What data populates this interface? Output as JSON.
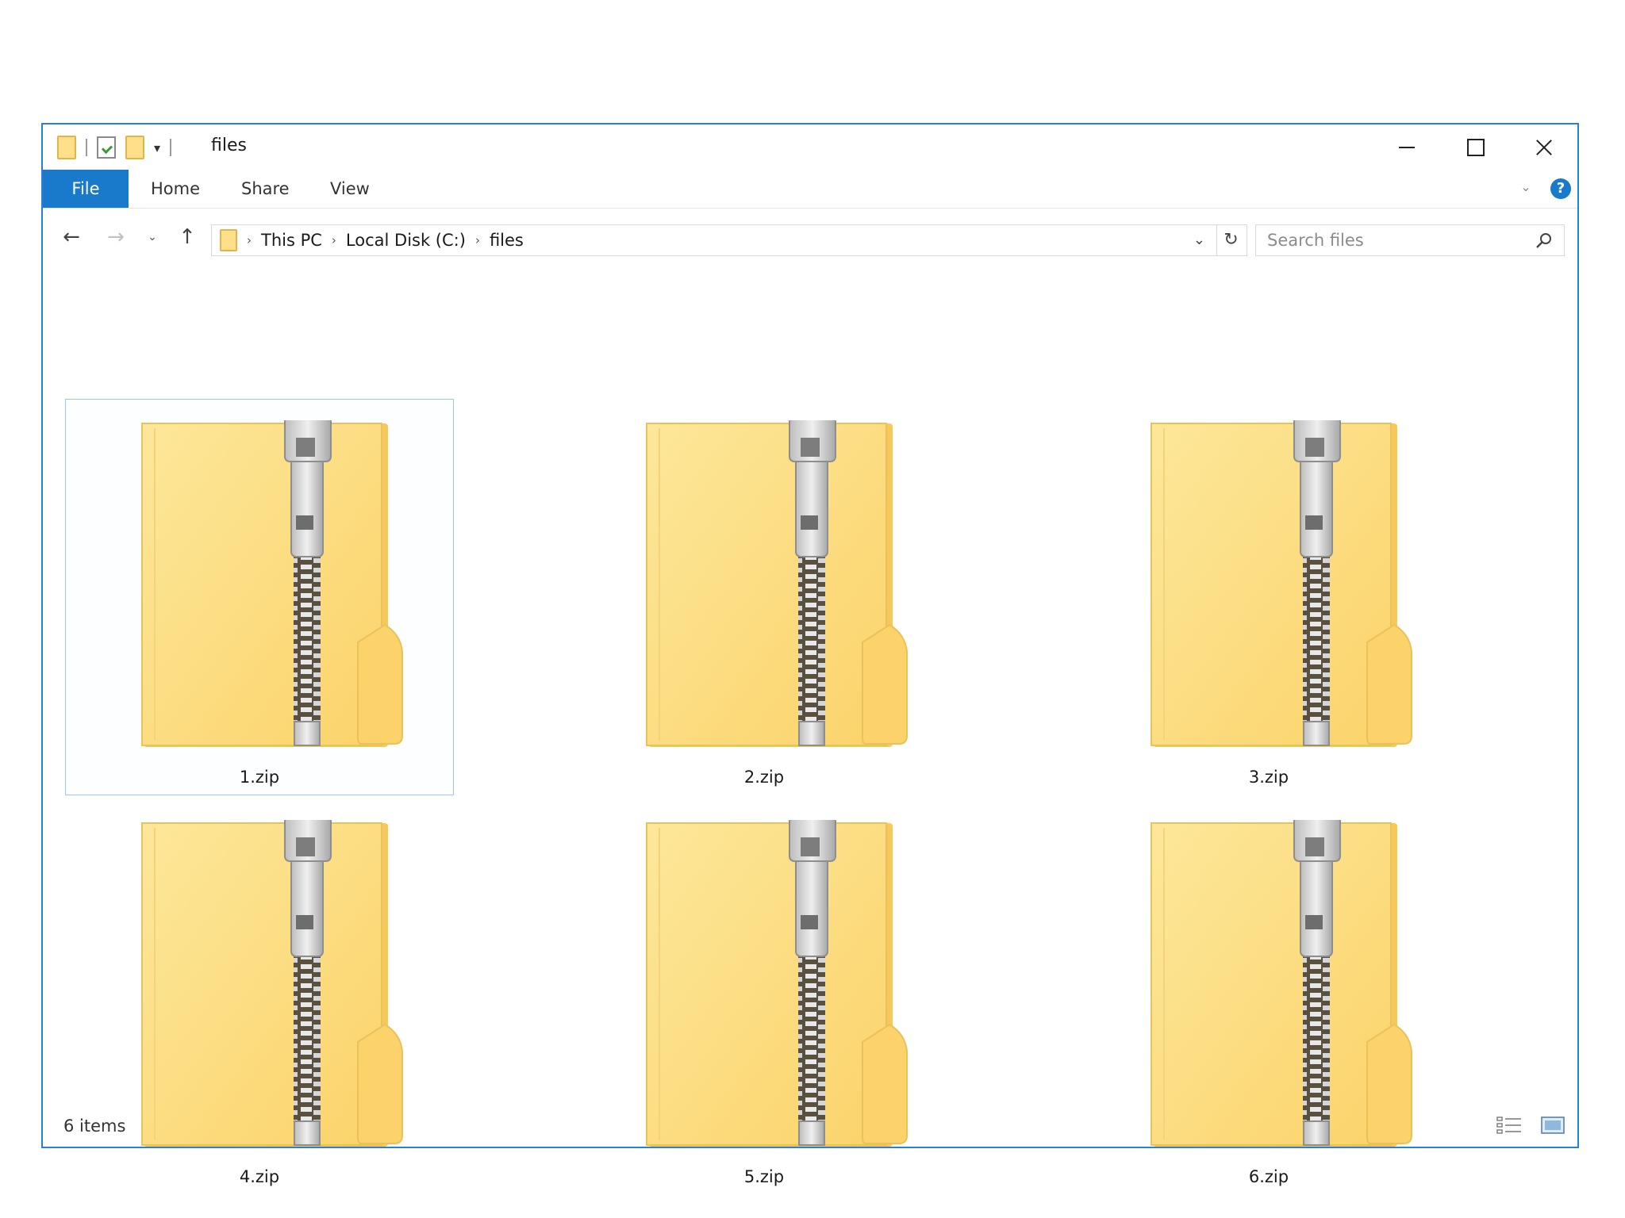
{
  "window": {
    "title": "files"
  },
  "ribbon": {
    "tabs": [
      "File",
      "Home",
      "Share",
      "View"
    ],
    "help": "?"
  },
  "nav": {
    "breadcrumb": [
      "This PC",
      "Local Disk (C:)",
      "files"
    ],
    "search_placeholder": "Search files"
  },
  "files": [
    {
      "name": "1.zip",
      "selected": true
    },
    {
      "name": "2.zip",
      "selected": false
    },
    {
      "name": "3.zip",
      "selected": false
    },
    {
      "name": "4.zip",
      "selected": false
    },
    {
      "name": "5.zip",
      "selected": false
    },
    {
      "name": "6.zip",
      "selected": false
    }
  ],
  "status": {
    "item_count": "6 items"
  },
  "colors": {
    "accent": "#1979ca",
    "window_border": "#2b7fd6",
    "selection_border": "#99c9ef",
    "folder_yellow": "#ffe08a"
  },
  "icons": [
    "zip-folder-icon",
    "back-arrow-icon",
    "forward-arrow-icon",
    "up-arrow-icon",
    "refresh-icon",
    "search-icon",
    "help-icon"
  ]
}
